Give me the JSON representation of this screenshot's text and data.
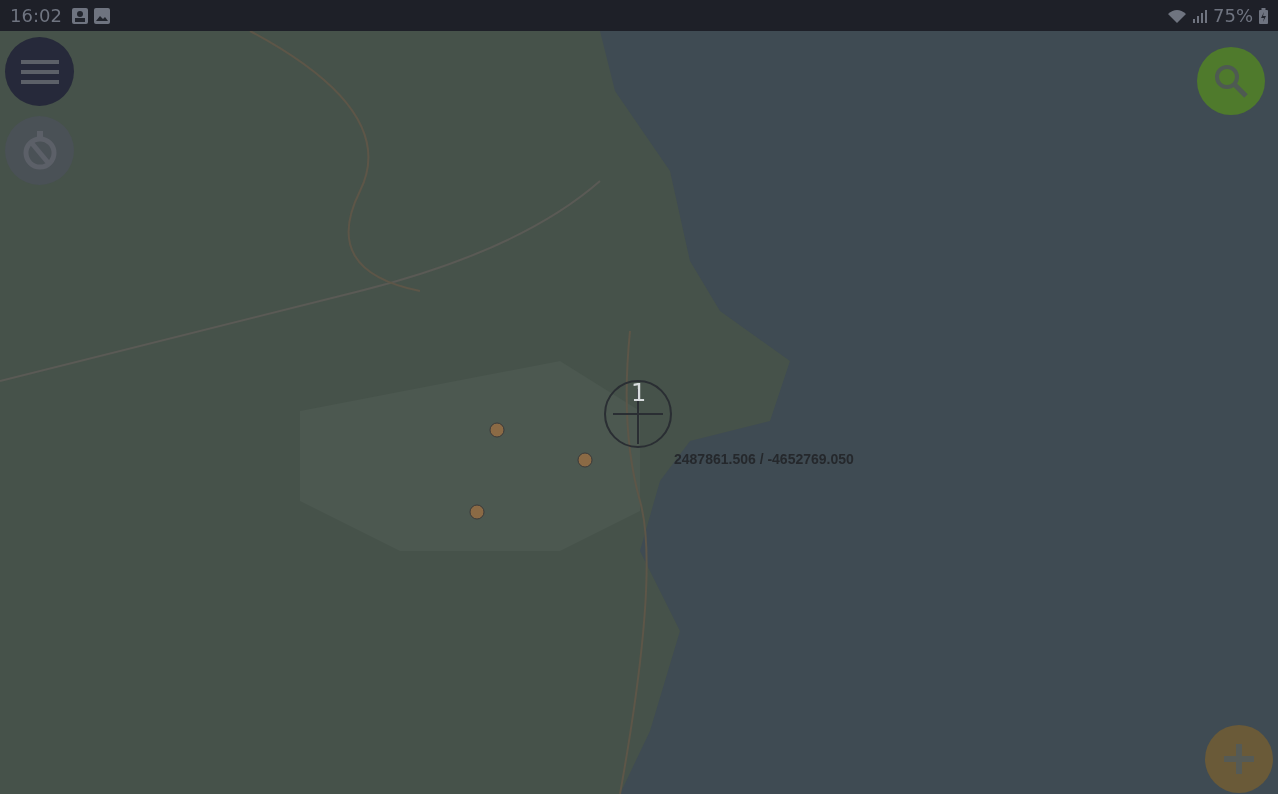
{
  "status_bar": {
    "time": "16:02",
    "battery": "75%"
  },
  "crosshair": {
    "label": "1",
    "coordinates": "2487861.506 / -4652769.050"
  }
}
